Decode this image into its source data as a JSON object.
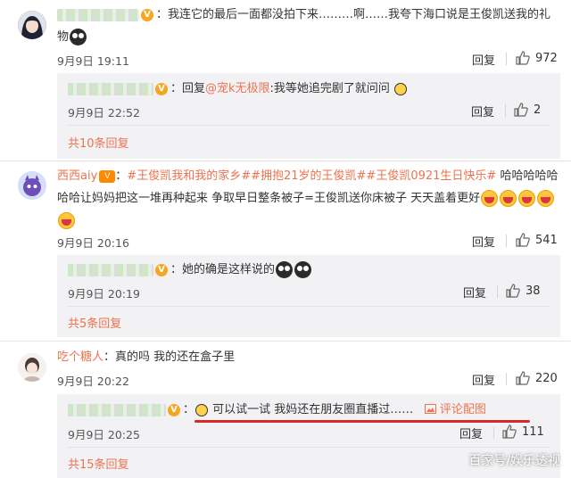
{
  "comments": [
    {
      "username": "",
      "text": "：我连它的最后一面都没拍下来………啊……我夸下海口说是王俊凯送我的礼物",
      "time": "9月9日 19:11",
      "reply_label": "回复",
      "like_count": "972",
      "replies": [
        {
          "text_prefix": "：回复",
          "mention": "@宠k无极限",
          "text": ":我等她追完剧了就问问",
          "time": "9月9日 22:52",
          "reply_label": "回复",
          "like_count": "2"
        }
      ],
      "more_replies": "共10条回复"
    },
    {
      "username": "西西aiy",
      "vip_badge": "V",
      "topics": [
        "#王俊凯我和我的家乡#",
        "#拥抱21岁的王俊凯#",
        "#王俊凯0921生日快乐#"
      ],
      "text": "哈哈哈哈哈哈哈让妈妈把这一堆再种起来 争取早日整条被子=王俊凯送你床被子  天天盖着更好",
      "time": "9月9日 20:16",
      "reply_label": "回复",
      "like_count": "541",
      "replies": [
        {
          "text": "：她的确是这样说的",
          "time": "9月9日 20:19",
          "reply_label": "回复",
          "like_count": "38"
        }
      ],
      "more_replies": "共5条回复"
    },
    {
      "username": "吃个糖人",
      "text": "：真的吗  我的还在盒子里",
      "time": "9月9日 20:22",
      "reply_label": "回复",
      "like_count": "220",
      "replies": [
        {
          "text": "可以试一试 我妈还在朋友圈直播过……",
          "pic_link": "评论配图",
          "time": "9月9日 20:25",
          "reply_label": "回复",
          "like_count": "111"
        }
      ],
      "more_replies": "共15条回复"
    }
  ],
  "watermark": "百家号/娱乐透视",
  "colors": {
    "accent": "#eb7350",
    "underline": "#d62a2a",
    "reply_bg": "#f2f2f5"
  }
}
